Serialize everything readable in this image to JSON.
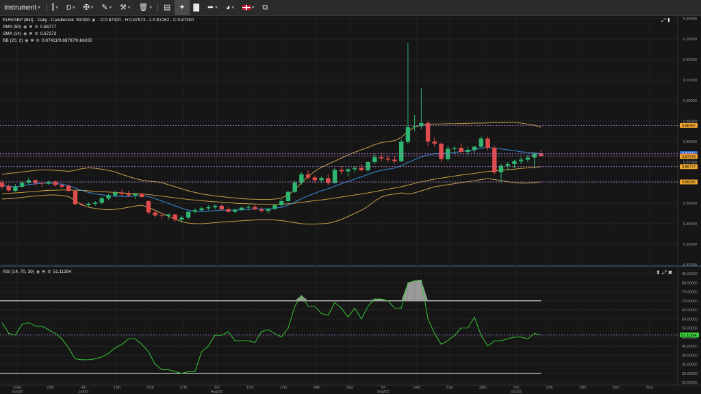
{
  "toolbar": {
    "instrument_label": "Instrument",
    "timeframe_label": "D",
    "caret": "▾"
  },
  "main_legend": {
    "title": "EUR/GBP (Bid) - Daily - Candlestick",
    "bars": "90/300",
    "ohlc": "- O:0.87420 - H:0.87573 - L:0.87262 - C:0.87300",
    "indicators": [
      {
        "name": "SMA (50)",
        "value": "0.86777"
      },
      {
        "name": "SMA (14)",
        "value": "0.87273"
      },
      {
        "name": "BB (20, 2)",
        "value": "0.87411/0.88787/0.86035"
      }
    ]
  },
  "rsi_legend": {
    "name": "RSI (14, 70, 30)",
    "value": "51.11394"
  },
  "price_axis": [
    "0.94000",
    "0.93000",
    "0.92000",
    "0.91000",
    "0.90000",
    "0.89000",
    "0.88000",
    "0.87000",
    "0.86000",
    "0.85000",
    "0.84000",
    "0.83000",
    "0.82000"
  ],
  "rsi_axis": [
    "85.00000",
    "80.00000",
    "75.00000",
    "70.00000",
    "65.00000",
    "60.00000",
    "55.00000",
    "50.00000",
    "45.00000",
    "40.00000",
    "35.00000",
    "30.00000",
    "25.00000"
  ],
  "price_tags": [
    {
      "label": "0.88787",
      "price": 0.88787,
      "bg": "#f0a830",
      "fg": "#000000"
    },
    {
      "label": "0.87411",
      "price": 0.87411,
      "bg": "#2f7de0",
      "fg": "#ffffff"
    },
    {
      "label": "0.87300",
      "price": 0.873,
      "bg": "#e03c3c",
      "fg": "#ffffff"
    },
    {
      "label": "0.87273",
      "price": 0.87273,
      "bg": "#f0a830",
      "fg": "#000000"
    },
    {
      "label": "0.86777",
      "price": 0.86777,
      "bg": "#f0a830",
      "fg": "#000000"
    },
    {
      "label": "0.86035",
      "price": 0.86035,
      "bg": "#f0a830",
      "fg": "#000000"
    }
  ],
  "rsi_tag": {
    "label": "51.11394",
    "value": 51.11394,
    "bg": "#3bd13b",
    "fg": "#000000"
  },
  "x_axis": [
    {
      "day": "22nd",
      "month": "Jun/22"
    },
    {
      "day": "29th",
      "month": ""
    },
    {
      "day": "6th",
      "month": "Jul/22"
    },
    {
      "day": "13th",
      "month": ""
    },
    {
      "day": "20th",
      "month": ""
    },
    {
      "day": "27th",
      "month": ""
    },
    {
      "day": "3rd",
      "month": "Aug/22"
    },
    {
      "day": "10th",
      "month": ""
    },
    {
      "day": "17th",
      "month": ""
    },
    {
      "day": "24th",
      "month": ""
    },
    {
      "day": "31st",
      "month": ""
    },
    {
      "day": "7th",
      "month": "Sep/22"
    },
    {
      "day": "14th",
      "month": ""
    },
    {
      "day": "21st",
      "month": ""
    },
    {
      "day": "28th",
      "month": ""
    },
    {
      "day": "5th",
      "month": "Oct/22"
    },
    {
      "day": "12th",
      "month": ""
    },
    {
      "day": "19th",
      "month": ""
    },
    {
      "day": "26th",
      "month": ""
    },
    {
      "day": "31st",
      "month": ""
    }
  ],
  "colors": {
    "up": "#2db66f",
    "down": "#e04b4b",
    "sma50": "#c8a040",
    "sma14": "#3a8de0",
    "bb": "#c9a14a",
    "rsi": "#37c837",
    "dashed": "#b07fcf"
  },
  "chart_data": {
    "type": "candlestick",
    "candles": [
      [
        0.86,
        0.8612,
        0.857,
        0.858
      ],
      [
        0.8582,
        0.8592,
        0.8556,
        0.8562
      ],
      [
        0.856,
        0.8592,
        0.8555,
        0.858
      ],
      [
        0.858,
        0.861,
        0.8575,
        0.86
      ],
      [
        0.86,
        0.8625,
        0.859,
        0.8612
      ],
      [
        0.8612,
        0.8615,
        0.8585,
        0.8598
      ],
      [
        0.8598,
        0.8605,
        0.858,
        0.8595
      ],
      [
        0.8595,
        0.861,
        0.8588,
        0.8605
      ],
      [
        0.8605,
        0.8612,
        0.858,
        0.8588
      ],
      [
        0.8588,
        0.8595,
        0.857,
        0.858
      ],
      [
        0.8585,
        0.859,
        0.8555,
        0.856
      ],
      [
        0.856,
        0.8565,
        0.849,
        0.8495
      ],
      [
        0.8495,
        0.8502,
        0.8485,
        0.849
      ],
      [
        0.849,
        0.8505,
        0.848,
        0.8497
      ],
      [
        0.8497,
        0.851,
        0.8488,
        0.8502
      ],
      [
        0.8502,
        0.853,
        0.8495,
        0.8523
      ],
      [
        0.8523,
        0.8545,
        0.8515,
        0.8538
      ],
      [
        0.8538,
        0.856,
        0.853,
        0.8552
      ],
      [
        0.8552,
        0.8565,
        0.8535,
        0.8545
      ],
      [
        0.8545,
        0.856,
        0.853,
        0.8538
      ],
      [
        0.8538,
        0.855,
        0.852,
        0.8545
      ],
      [
        0.8545,
        0.855,
        0.8525,
        0.853
      ],
      [
        0.851,
        0.8515,
        0.8445,
        0.8455
      ],
      [
        0.8455,
        0.8465,
        0.843,
        0.844
      ],
      [
        0.844,
        0.8452,
        0.8425,
        0.8438
      ],
      [
        0.8438,
        0.845,
        0.842,
        0.8445
      ],
      [
        0.8445,
        0.8448,
        0.841,
        0.842
      ],
      [
        0.842,
        0.844,
        0.8405,
        0.843
      ],
      [
        0.843,
        0.846,
        0.842,
        0.8458
      ],
      [
        0.8458,
        0.8475,
        0.845,
        0.8466
      ],
      [
        0.8466,
        0.8482,
        0.846,
        0.8475
      ],
      [
        0.8475,
        0.849,
        0.8465,
        0.848
      ],
      [
        0.848,
        0.8495,
        0.847,
        0.8487
      ],
      [
        0.8487,
        0.8495,
        0.8465,
        0.847
      ],
      [
        0.847,
        0.8482,
        0.8455,
        0.8458
      ],
      [
        0.8458,
        0.8475,
        0.845,
        0.8468
      ],
      [
        0.8468,
        0.8485,
        0.846,
        0.8478
      ],
      [
        0.8478,
        0.849,
        0.8465,
        0.8482
      ],
      [
        0.8482,
        0.8498,
        0.8465,
        0.847
      ],
      [
        0.847,
        0.848,
        0.8455,
        0.8462
      ],
      [
        0.8462,
        0.8475,
        0.845,
        0.8472
      ],
      [
        0.8472,
        0.8495,
        0.8468,
        0.849
      ],
      [
        0.849,
        0.852,
        0.848,
        0.851
      ],
      [
        0.851,
        0.856,
        0.8505,
        0.8555
      ],
      [
        0.8555,
        0.861,
        0.855,
        0.86
      ],
      [
        0.86,
        0.865,
        0.859,
        0.864
      ],
      [
        0.864,
        0.866,
        0.8615,
        0.8625
      ],
      [
        0.8625,
        0.8635,
        0.86,
        0.8612
      ],
      [
        0.8612,
        0.863,
        0.86,
        0.8622
      ],
      [
        0.8622,
        0.864,
        0.859,
        0.8598
      ],
      [
        0.8598,
        0.867,
        0.8595,
        0.8662
      ],
      [
        0.8662,
        0.868,
        0.864,
        0.8655
      ],
      [
        0.8655,
        0.8672,
        0.863,
        0.8665
      ],
      [
        0.8665,
        0.868,
        0.865,
        0.8672
      ],
      [
        0.8672,
        0.869,
        0.8655,
        0.866
      ],
      [
        0.866,
        0.8705,
        0.8652,
        0.87
      ],
      [
        0.87,
        0.874,
        0.869,
        0.8725
      ],
      [
        0.8725,
        0.8745,
        0.8705,
        0.8718
      ],
      [
        0.8718,
        0.8732,
        0.87,
        0.8712
      ],
      [
        0.8712,
        0.873,
        0.8695,
        0.8705
      ],
      [
        0.8705,
        0.881,
        0.87,
        0.88
      ],
      [
        0.88,
        0.928,
        0.879,
        0.887
      ],
      [
        0.887,
        0.893,
        0.885,
        0.8875
      ],
      [
        0.8875,
        0.906,
        0.886,
        0.889
      ],
      [
        0.889,
        0.89,
        0.878,
        0.88
      ],
      [
        0.88,
        0.882,
        0.8775,
        0.879
      ],
      [
        0.879,
        0.8795,
        0.87,
        0.8715
      ],
      [
        0.8715,
        0.878,
        0.8705,
        0.8765
      ],
      [
        0.8765,
        0.878,
        0.874,
        0.877
      ],
      [
        0.877,
        0.879,
        0.874,
        0.875
      ],
      [
        0.875,
        0.8775,
        0.8735,
        0.876
      ],
      [
        0.876,
        0.878,
        0.874,
        0.8775
      ],
      [
        0.8775,
        0.8825,
        0.877,
        0.8815
      ],
      [
        0.8815,
        0.8825,
        0.8755,
        0.877
      ],
      [
        0.877,
        0.878,
        0.864,
        0.865
      ],
      [
        0.865,
        0.869,
        0.86,
        0.8682
      ],
      [
        0.8682,
        0.87,
        0.8665,
        0.869
      ],
      [
        0.869,
        0.871,
        0.867,
        0.8705
      ],
      [
        0.8705,
        0.8725,
        0.869,
        0.8712
      ],
      [
        0.8712,
        0.8735,
        0.87,
        0.8722
      ],
      [
        0.8722,
        0.874,
        0.867,
        0.8742
      ],
      [
        0.8742,
        0.8757,
        0.8726,
        0.873
      ]
    ],
    "sma14": [
      0.8585,
      0.8582,
      0.858,
      0.8584,
      0.859,
      0.8594,
      0.8596,
      0.8598,
      0.8596,
      0.8592,
      0.8586,
      0.8574,
      0.8562,
      0.8552,
      0.8546,
      0.8541,
      0.8536,
      0.8534,
      0.8533,
      0.8532,
      0.8535,
      0.8538,
      0.8532,
      0.8522,
      0.851,
      0.8499,
      0.8487,
      0.8475,
      0.8466,
      0.846,
      0.8459,
      0.8461,
      0.8464,
      0.8466,
      0.8466,
      0.8467,
      0.8468,
      0.847,
      0.8471,
      0.8472,
      0.8472,
      0.8475,
      0.848,
      0.849,
      0.8505,
      0.8522,
      0.8536,
      0.8548,
      0.856,
      0.857,
      0.8583,
      0.8595,
      0.8606,
      0.8618,
      0.8628,
      0.864,
      0.8652,
      0.866,
      0.8666,
      0.8671,
      0.8682,
      0.8698,
      0.8712,
      0.8726,
      0.8735,
      0.8741,
      0.8742,
      0.8744,
      0.8747,
      0.8752,
      0.8756,
      0.876,
      0.8768,
      0.8772,
      0.8768,
      0.8764,
      0.876,
      0.8756,
      0.875,
      0.8748,
      0.8745,
      0.8741
    ],
    "sma50": [
      0.8545,
      0.8548,
      0.855,
      0.8552,
      0.8555,
      0.8557,
      0.856,
      0.8562,
      0.8563,
      0.8564,
      0.8564,
      0.8563,
      0.8562,
      0.856,
      0.8558,
      0.8556,
      0.8554,
      0.8552,
      0.855,
      0.8548,
      0.8547,
      0.8545,
      0.8542,
      0.8538,
      0.8534,
      0.853,
      0.8526,
      0.8522,
      0.8518,
      0.8515,
      0.8512,
      0.8509,
      0.8507,
      0.8505,
      0.8502,
      0.85,
      0.8498,
      0.8497,
      0.8496,
      0.8495,
      0.8494,
      0.8494,
      0.8495,
      0.8497,
      0.85,
      0.8504,
      0.8508,
      0.8512,
      0.8516,
      0.852,
      0.8525,
      0.853,
      0.8535,
      0.854,
      0.8545,
      0.855,
      0.8556,
      0.8562,
      0.8568,
      0.8574,
      0.858,
      0.8588,
      0.8596,
      0.8604,
      0.8611,
      0.8617,
      0.8622,
      0.8627,
      0.8632,
      0.8637,
      0.8641,
      0.8645,
      0.865,
      0.8654,
      0.8657,
      0.866,
      0.8663,
      0.8666,
      0.8669,
      0.8672,
      0.8675,
      0.8678
    ],
    "bb_upper": [
      0.864,
      0.8645,
      0.8648,
      0.8652,
      0.8656,
      0.866,
      0.8662,
      0.8662,
      0.866,
      0.8658,
      0.8655,
      0.866,
      0.8668,
      0.8672,
      0.867,
      0.8665,
      0.866,
      0.8652,
      0.864,
      0.863,
      0.862,
      0.8612,
      0.8608,
      0.8605,
      0.86,
      0.859,
      0.858,
      0.857,
      0.856,
      0.8552,
      0.8545,
      0.854,
      0.8535,
      0.8532,
      0.8528,
      0.8525,
      0.8522,
      0.852,
      0.8519,
      0.8518,
      0.8518,
      0.852,
      0.8525,
      0.854,
      0.8565,
      0.86,
      0.863,
      0.8655,
      0.8675,
      0.869,
      0.8705,
      0.872,
      0.8735,
      0.8748,
      0.876,
      0.8772,
      0.8785,
      0.8795,
      0.88,
      0.8805,
      0.882,
      0.885,
      0.887,
      0.888,
      0.8885,
      0.8886,
      0.8886,
      0.8887,
      0.8887,
      0.8888,
      0.8889,
      0.889,
      0.889,
      0.8891,
      0.8892,
      0.8892,
      0.8893,
      0.8893,
      0.889,
      0.8885,
      0.888,
      0.887
    ],
    "bb_lower": [
      0.852,
      0.8522,
      0.8524,
      0.8528,
      0.8532,
      0.8535,
      0.8537,
      0.854,
      0.854,
      0.8537,
      0.8532,
      0.8512,
      0.8492,
      0.848,
      0.8474,
      0.847,
      0.8468,
      0.847,
      0.8474,
      0.848,
      0.8486,
      0.849,
      0.848,
      0.8465,
      0.845,
      0.8436,
      0.8422,
      0.841,
      0.8403,
      0.84,
      0.84,
      0.8402,
      0.8405,
      0.8408,
      0.841,
      0.8412,
      0.8414,
      0.8416,
      0.8418,
      0.842,
      0.842,
      0.8418,
      0.8415,
      0.841,
      0.8405,
      0.84,
      0.8398,
      0.8398,
      0.84,
      0.8402,
      0.841,
      0.842,
      0.8435,
      0.845,
      0.8465,
      0.8485,
      0.851,
      0.853,
      0.854,
      0.8545,
      0.855,
      0.8545,
      0.855,
      0.856,
      0.857,
      0.858,
      0.8585,
      0.859,
      0.8595,
      0.86,
      0.8605,
      0.861,
      0.8615,
      0.862,
      0.8615,
      0.861,
      0.8605,
      0.86,
      0.8598,
      0.8598,
      0.86,
      0.8604
    ],
    "rsi": [
      58,
      52,
      51,
      57,
      58,
      56,
      56,
      54,
      52,
      49,
      44,
      38,
      37.5,
      37.5,
      38,
      39,
      41,
      44,
      46,
      49,
      49,
      46,
      42,
      35,
      32,
      32,
      31,
      30,
      31,
      31,
      42,
      45,
      51,
      51,
      53,
      48,
      48,
      48,
      47,
      53,
      54,
      52,
      50,
      55,
      67,
      73,
      67,
      67,
      63,
      62,
      69,
      66,
      61,
      66,
      60,
      67,
      71,
      71,
      70,
      66,
      66,
      80,
      81,
      81.5,
      60,
      52,
      46,
      48,
      51,
      55,
      55,
      61,
      51,
      45,
      48,
      48,
      49,
      50,
      50,
      49,
      52,
      51.1
    ],
    "rsi_levels": {
      "overbought": 70,
      "oversold": 30
    },
    "price_range": [
      0.82,
      0.94
    ],
    "rsi_range": [
      25,
      85
    ]
  }
}
